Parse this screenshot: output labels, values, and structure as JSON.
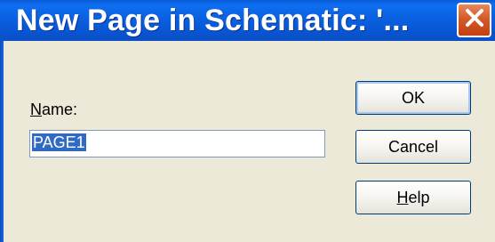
{
  "window": {
    "title": "New Page in Schematic: '...",
    "close_icon": "close-icon"
  },
  "form": {
    "name_label_accel": "N",
    "name_label_rest": "ame:",
    "name_value": "PAGE1"
  },
  "buttons": {
    "ok_label": "OK",
    "cancel_label": "Cancel",
    "help_accel": "H",
    "help_rest": "elp"
  },
  "colors": {
    "titlebar": "#0a5bd6",
    "close_button": "#d45a2a",
    "dialog_bg": "#ece9d8",
    "selection": "#316ac5"
  }
}
